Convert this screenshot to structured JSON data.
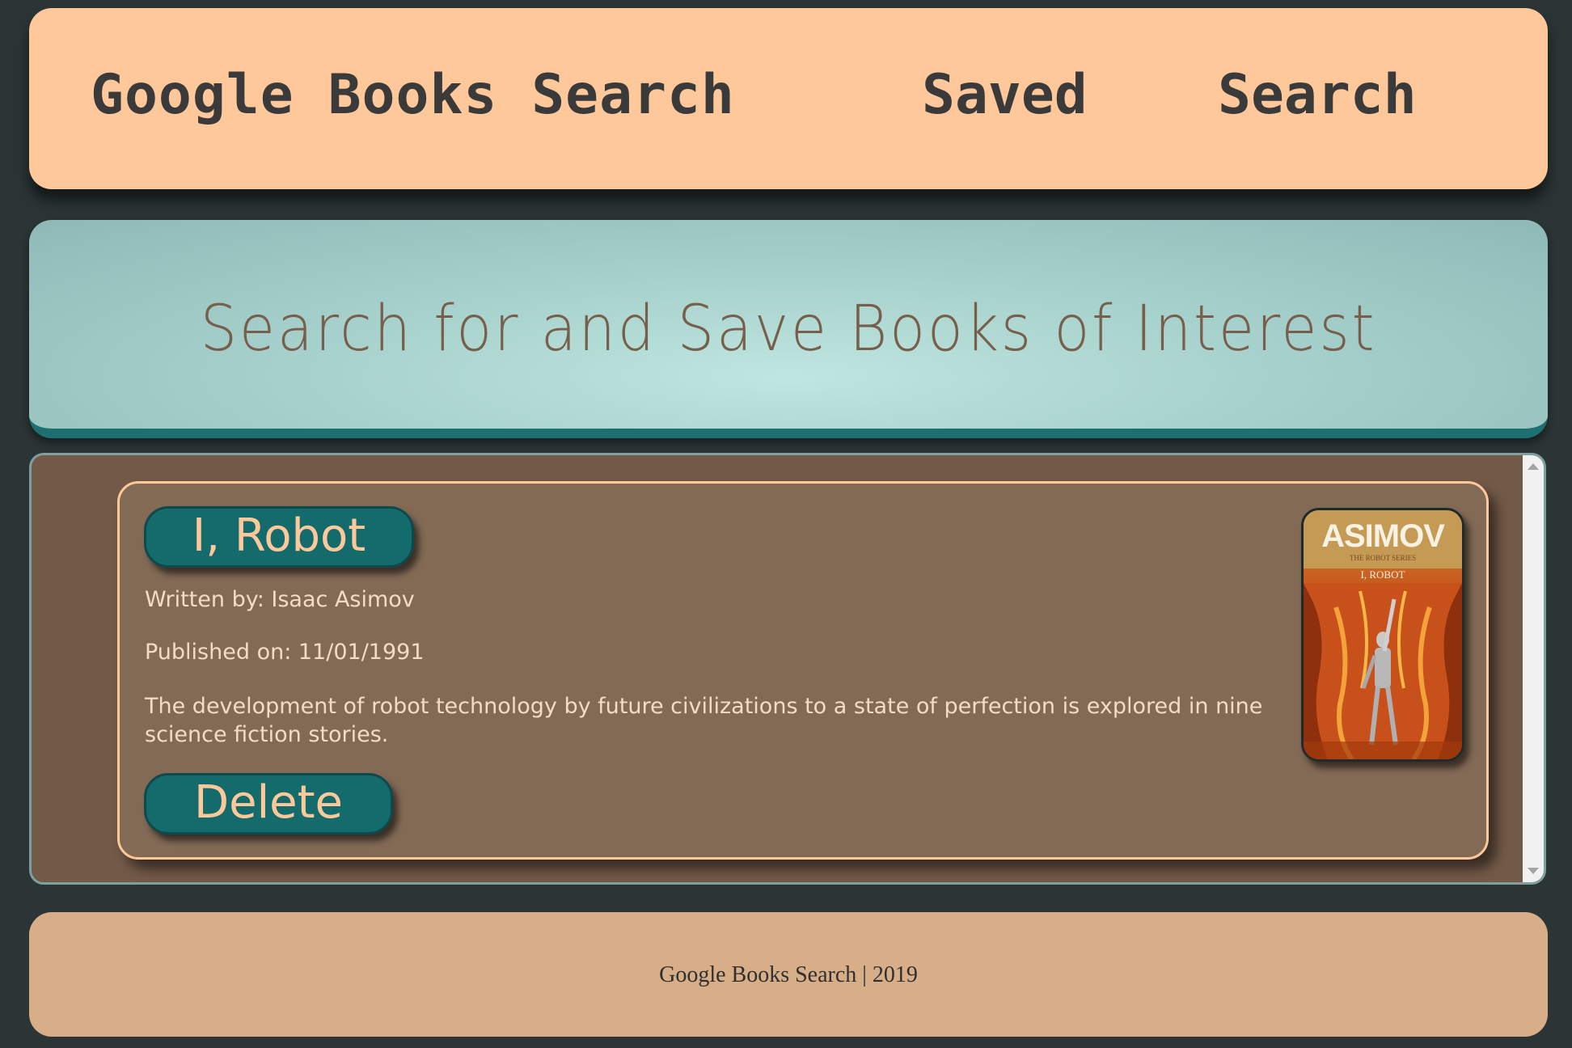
{
  "navbar": {
    "brand": "Google Books Search",
    "links": [
      {
        "label": "Saved"
      },
      {
        "label": "Search"
      }
    ],
    "background": "#fec89a"
  },
  "jumbotron": {
    "title": "Search for and Save Books of Interest"
  },
  "results": {
    "books": [
      {
        "title": "I, Robot",
        "author_line": "Written by: Isaac Asimov",
        "published_line": "Published on: 11/01/1991",
        "description": "The development of robot technology by future civilizations to a state of perfection is explored in nine science fiction stories.",
        "delete_label": "Delete",
        "cover": {
          "author": "ASIMOV",
          "series": "THE ROBOT SERIES",
          "title": "I, ROBOT"
        }
      }
    ]
  },
  "footer": {
    "text": "Google Books Search | 2019"
  },
  "colors": {
    "accent_teal": "#146b6c",
    "card_brown": "#826a55",
    "peach": "#fec89a",
    "page_background": "#2b3535"
  }
}
